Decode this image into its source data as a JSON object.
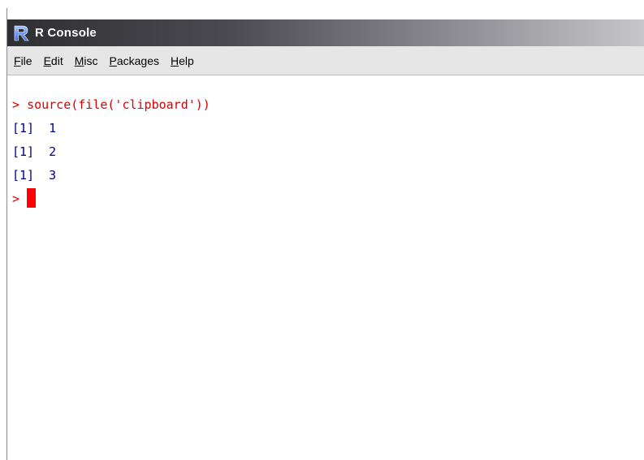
{
  "window": {
    "title": "R Console",
    "icon": "r-logo-icon"
  },
  "menu": {
    "items": [
      {
        "label_u": "F",
        "label_rest": "ile"
      },
      {
        "label_u": "E",
        "label_rest": "dit"
      },
      {
        "label_u": "M",
        "label_rest": "isc"
      },
      {
        "label_u": "P",
        "label_rest": "ackages"
      },
      {
        "label_u": "H",
        "label_rest": "elp"
      }
    ]
  },
  "console": {
    "command_prompt": "> ",
    "command": "source(file('clipboard'))",
    "outputs": [
      "[1]  1",
      "[1]  2",
      "[1]  3"
    ],
    "input_prompt": "> ",
    "colors": {
      "input": "#d80000",
      "output": "#00008b",
      "cursor": "#ff0000"
    }
  }
}
